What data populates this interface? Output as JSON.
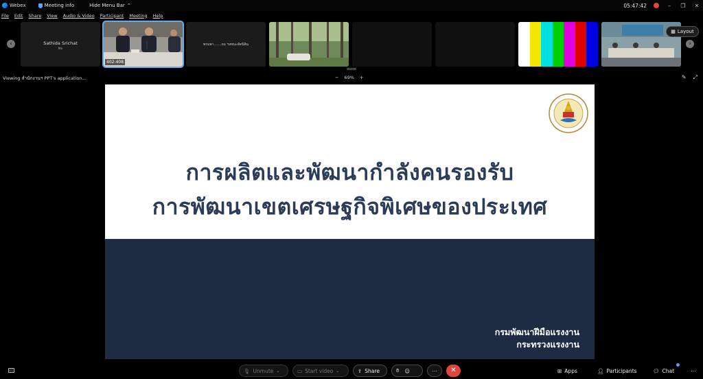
{
  "titlebar": {
    "app_name": "Webex",
    "meeting_info": "Meeting info",
    "hide_menu_bar": "Hide Menu Bar",
    "time": "05:47:42"
  },
  "menu": [
    "File",
    "Edit",
    "Share",
    "View",
    "Audio & Video",
    "Participant",
    "Meeting",
    "Help"
  ],
  "participants": [
    {
      "name": "Sathida Srichat",
      "sub": "Me"
    },
    {
      "label": "402-408"
    },
    {
      "text": "พรมพา.......ถม ฯสชนะสัตนิลิน"
    }
  ],
  "layout_button": "Layout",
  "viewbar": {
    "viewing": "Viewing สำนักงานฯ PPT's application...",
    "zoom_out": "−",
    "zoom": "69%",
    "zoom_in": "+"
  },
  "slide": {
    "title_line1": "การผลิตและพัฒนากำลังคนรองรับ",
    "title_line2": "การพัฒนาเขตเศรษฐกิจพิเศษของประเทศ",
    "org_line1": "กรมพัฒนาฝีมือแรงงาน",
    "org_line2": "กระทรวงแรงงาน"
  },
  "controls": {
    "unmute": "Unmute",
    "start_video": "Start video",
    "share": "Share",
    "apps": "Apps",
    "participants": "Participants",
    "chat": "Chat"
  },
  "colors": {
    "slide_title": "#2a3c57",
    "slide_band": "#1e2b43",
    "end_call": "#e0463d",
    "active_tile": "#62a9f0"
  }
}
